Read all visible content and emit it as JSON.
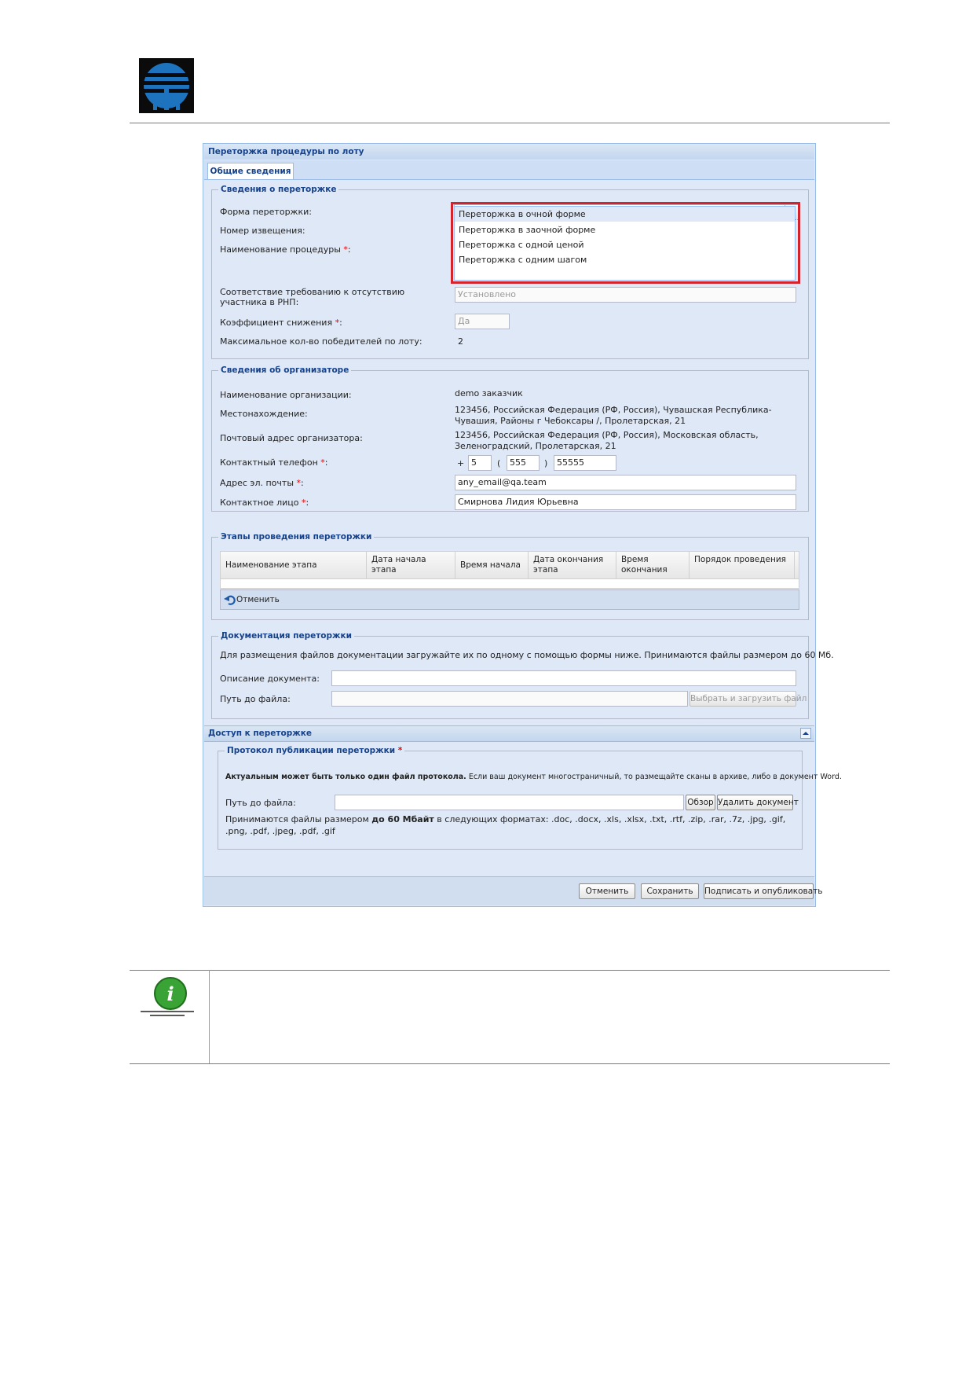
{
  "window_title": "Переторжка процедуры по лоту",
  "tabs": [
    "Общие сведения"
  ],
  "section_info": {
    "legend": "Сведения о переторжке",
    "forma_label": "Форма переторжки:",
    "forma_value": "",
    "nomer_label": "Номер извещения:",
    "naim_label": "Наименование процедуры",
    "sootv_label": "Соответствие требованию к отсутствию участника в РНП:",
    "sootv_value": "Установлено",
    "koef_label": "Коэффициент снижения",
    "koef_value": "Да",
    "max_label": "Максимальное кол-во победителей по лоту:",
    "max_value": "2",
    "required_mark": "*",
    "colon": ":"
  },
  "dropdown": {
    "options": [
      "Переторжка в очной форме",
      "Переторжка в заочной форме",
      "Переторжка с одной ценой",
      "Переторжка с одним шагом"
    ]
  },
  "section_org": {
    "legend": "Сведения об организаторе",
    "name_label": "Наименование организации:",
    "name_value": "demo заказчик",
    "loc_label": "Местонахождение:",
    "loc_value": "123456, Российская Федерация (РФ, Россия), Чувашская Республика-Чувашия, Районы г Чебоксары /, Пролетарская, 21",
    "post_label": "Почтовый адрес организатора:",
    "post_value": "123456, Российская Федерация (РФ, Россия), Московская область, Зеленоградский, Пролетарская, 21",
    "phone_label": "Контактный телефон",
    "phone_plus": "+",
    "phone_country": "5",
    "phone_open": "(",
    "phone_code": "555",
    "phone_close": ")",
    "phone_number": "55555",
    "email_label": "Адрес эл. почты",
    "email_value": "any_email@qa.team",
    "contact_label": "Контактное лицо",
    "contact_value": "Смирнова Лидия Юрьевна"
  },
  "section_stages": {
    "legend": "Этапы проведения переторжки",
    "columns": [
      "Наименование этапа",
      "Дата начала этапа",
      "Время начала",
      "Дата окончания этапа",
      "Время окончания",
      "Порядок проведения"
    ],
    "cancel_label": "Отменить"
  },
  "section_docs": {
    "legend": "Документация переторжки",
    "hint": "Для размещения файлов документации загружайте их по одному с помощью формы ниже. Принимаются файлы размером до 60 Мб.",
    "desc_label": "Описание документа:",
    "path_label": "Путь до файла:",
    "upload_button": "Выбрать и загрузить файл"
  },
  "access_panel": {
    "title": "Доступ к переторжке",
    "legend": "Протокол публикации переторжки",
    "note_bold": "Актуальным может быть только один файл протокола.",
    "note_rest": " Если ваш документ многостраничный, то размещайте сканы в архиве, либо в документ Word.",
    "path_label": "Путь до файла:",
    "browse_button": "Обзор",
    "delete_button": "Удалить документ",
    "formats_pre": "Принимаются файлы размером ",
    "formats_bold": "до 60 Мбайт",
    "formats_post": " в следующих форматах: .doc, .docx, .xls, .xlsx, .txt, .rtf, .zip, .rar, .7z, .jpg, .gif, .png, .pdf, .jpeg, .pdf, .gif"
  },
  "footer": {
    "cancel": "Отменить",
    "save": "Сохранить",
    "sign": "Подписать и опубликовать"
  },
  "colors": {
    "accent": "#15428b",
    "highlight_box": "#d4232b",
    "logo_blue": "#1e73be",
    "info_green": "#3aa335"
  },
  "icons": [
    "company-logo-icon",
    "trigger-arrow-icon",
    "undo-icon",
    "collapse-icon",
    "info-icon"
  ]
}
